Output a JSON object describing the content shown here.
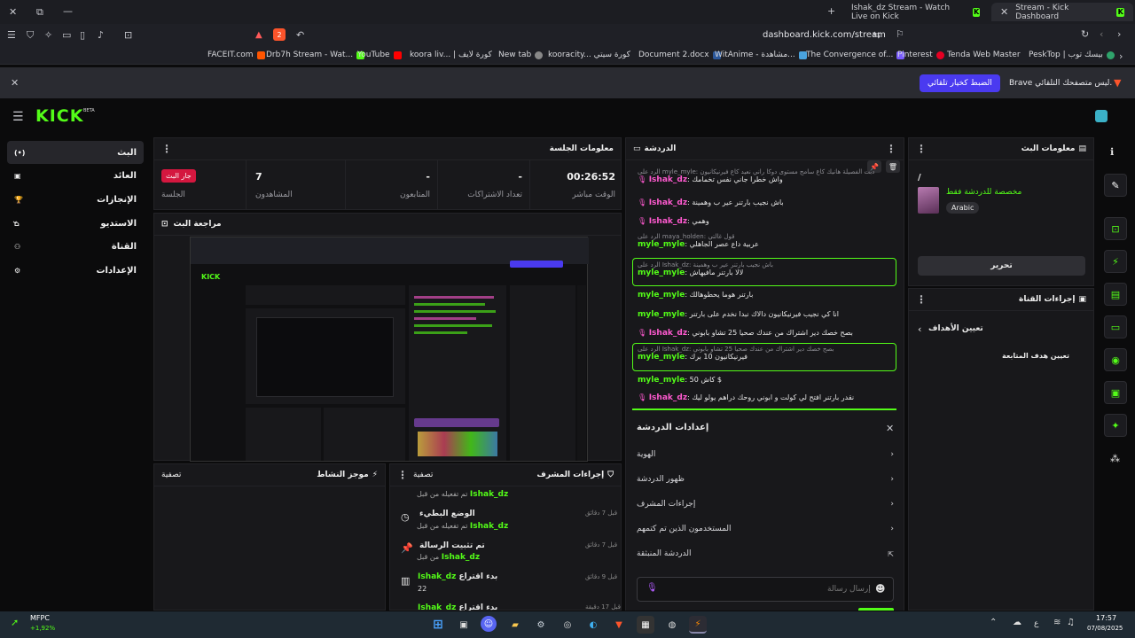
{
  "browser": {
    "tabs": [
      {
        "title": "Ishak_dz Stream - Watch Live on Kick"
      },
      {
        "title": "Stream - Kick Dashboard"
      }
    ],
    "url": "dashboard.kick.com/stream",
    "bookmarks": [
      "FACEIT.com",
      "Drb7h Stream - Wat...",
      "YouTube",
      "koora liv... | كورة لايف",
      "New tab",
      "kooracity... كورة سيتي",
      "Document 2.docx",
      "WitAnime - مشاهدة...",
      "The Convergence of...",
      "Pinterest",
      "Tenda Web Master",
      "PeskTop | بيسك توب"
    ],
    "infobar_text": "Brave ليس متصفحك التلقائي.",
    "infobar_button": "الضبط كخيار تلقائي",
    "brave_badge": "2"
  },
  "kick": {
    "logo": "KICK",
    "logo_beta": "BETA",
    "nav": [
      {
        "label": "البث",
        "icon": "(•)"
      },
      {
        "label": "العائد",
        "icon": "▣"
      },
      {
        "label": "الإنجازات",
        "icon": "🏆"
      },
      {
        "label": "الاستديو",
        "icon": "⌂"
      },
      {
        "label": "القناة",
        "icon": "⚇"
      },
      {
        "label": "الإعدادات",
        "icon": "⚙"
      }
    ],
    "session": {
      "title": "معلومات الجلسة",
      "stats": [
        {
          "value": "00:26:52",
          "label": "الوقت مباشر"
        },
        {
          "value": "-",
          "label": "تعداد الاشتراكات"
        },
        {
          "value": "-",
          "label": "المتابعون"
        },
        {
          "value": "7",
          "label": "المشاهدون"
        },
        {
          "value": "جار البث",
          "label": "الجلسة"
        }
      ]
    },
    "preview_title": "مراجعة البث",
    "activity_title": "موجز النشاط",
    "activity_filter": "تصفية",
    "mod_title": "إجراءات المشرف",
    "mod_filter": "تصفية",
    "mod_items": [
      {
        "title": "",
        "by": "Ishak_dz",
        "by_prefix": "تم تفعيله من قبل",
        "time": ""
      },
      {
        "title": "الوضع البطيء",
        "by": "Ishak_dz",
        "by_prefix": "تم تفعيله من قبل",
        "time": "قبل 7 دقائق"
      },
      {
        "title": "تم تثبيت الرسالة",
        "by": "Ishak_dz",
        "by_prefix": "من قبل",
        "time": "قبل 7 دقائق"
      },
      {
        "title": "بدء اقتراع",
        "by": "Ishak_dz",
        "by_prefix": "22",
        "time": "قبل 9 دقائق"
      },
      {
        "title": "بدء اقتراع",
        "by": "Ishak_dz",
        "by_prefix": "",
        "time": "قبل 17 دقيقة"
      }
    ],
    "chat": {
      "title": "الدردشة",
      "messages": [
        {
          "reply": "الرد على myle_myle: دبت الفصيلة هانيك كاع سامح مستوى دوكا راني نعيد كاع فيرنيكانيون",
          "user": "Ishak_dz",
          "text": "واش خطرا جاني نفس تخمامك",
          "color": "pink"
        },
        {
          "reply": "",
          "user": "Ishak_dz",
          "text": "باش نجيب بارتنر عير ب وهمينة",
          "color": "pink"
        },
        {
          "reply": "",
          "user": "Ishak_dz",
          "text": "وهمي",
          "color": "pink"
        },
        {
          "reply": "الرد على maya_holden: قول غالتي",
          "user": "myle_myle",
          "text": "عربية داع عصر الجاهلي",
          "color": "green"
        },
        {
          "reply": "الرد على Ishak_dz: باش نجيب بارتنر عير ب وهمينة",
          "user": "myle_myle",
          "text": "لالا بارتنر مافيهاش",
          "color": "green"
        },
        {
          "reply": "",
          "user": "myle_myle",
          "text": "بارتنر هوما يحطوهالك",
          "color": "green"
        },
        {
          "reply": "",
          "user": "myle_myle",
          "text": "انا كي نجيب فيرنيكانيون دالاك نبدا نخدم على بارتنر",
          "color": "green"
        },
        {
          "reply": "",
          "user": "Ishak_dz",
          "text": "بصح خصك دير اشتراك من عندك صحيا 25 تشاو بابوني",
          "color": "pink"
        },
        {
          "reply": "الرد على Ishak_dz: بصح خصك دير اشتراك من عندك صحيا 25 تشاو بابوني",
          "user": "myle_myle",
          "text": "فيرنيكانيون 10 برك",
          "color": "green"
        },
        {
          "reply": "",
          "user": "myle_myle",
          "text": "كاش 50 $",
          "color": "green"
        },
        {
          "reply": "",
          "user": "Ishak_dz",
          "text": "نقدر بارتنر افتح لي كولت و ابوني روحك دراهم يولو ليك",
          "color": "pink"
        }
      ],
      "settings_title": "إعدادات الدردشة",
      "settings": [
        {
          "label": "الهوية"
        },
        {
          "label": "ظهور الدردشة"
        },
        {
          "label": "إجراءات المشرف"
        },
        {
          "label": "المستخدمون الذين تم كتمهم"
        },
        {
          "label": "الدردشة المنبثقة"
        }
      ],
      "input_placeholder": "إرسال رسالة"
    },
    "stream_info": {
      "title": "معلومات البث",
      "slash": "/",
      "category": "مخصصة للدردشة فقط",
      "tag": "Arabic",
      "edit_button": "تحرير"
    },
    "channel_actions": {
      "title": "إجراءات القناة",
      "goals": "تعيين الأهداف",
      "follow_goal": "تعيين هدف المتابعة"
    }
  },
  "taskbar": {
    "stock_name": "MFPC",
    "stock_change": "+1,92%",
    "time": "17:57",
    "date": "07/08/2025",
    "lang": "ع"
  }
}
